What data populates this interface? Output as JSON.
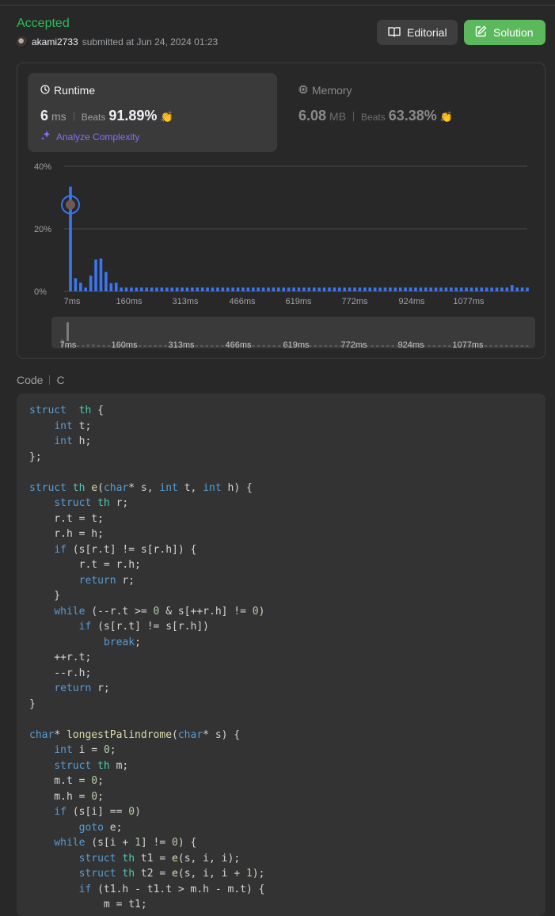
{
  "header": {
    "status": "Accepted",
    "username": "akami2733",
    "submitted_text": "submitted at Jun 24, 2024 01:23",
    "editorial_label": "Editorial",
    "solution_label": "Solution"
  },
  "runtime": {
    "title": "Runtime",
    "value": "6",
    "unit": "ms",
    "beats_label": "Beats",
    "beats_value": "91.89%",
    "analyze_label": "Analyze Complexity"
  },
  "memory": {
    "title": "Memory",
    "value": "6.08",
    "unit": "MB",
    "beats_label": "Beats",
    "beats_value": "63.38%"
  },
  "chart_data": {
    "type": "bar",
    "y_ticks": [
      "40%",
      "20%",
      "0%"
    ],
    "ylim": [
      0,
      40
    ],
    "x_tick_labels": [
      "7ms",
      "160ms",
      "313ms",
      "466ms",
      "619ms",
      "772ms",
      "924ms",
      "1077ms"
    ],
    "values": [
      33.5,
      4.2,
      2.8,
      1.2,
      5,
      10.2,
      10.5,
      6.2,
      2.6,
      2.8,
      1.2,
      1.2,
      1.2,
      1.2,
      1.2,
      1.2,
      1.2,
      1.2,
      1.2,
      1.2,
      1.2,
      1.2,
      1.2,
      1.2,
      1.2,
      1.2,
      1.2,
      1.2,
      1.2,
      1.2,
      1.2,
      1.2,
      1.2,
      1.2,
      1.2,
      1.2,
      1.2,
      1.2,
      1.2,
      1.2,
      1.2,
      1.2,
      1.2,
      1.2,
      1.2,
      1.2,
      1.2,
      1.2,
      1.2,
      1.2,
      1.2,
      1.2,
      1.2,
      1.2,
      1.2,
      1.2,
      1.2,
      1.2,
      1.2,
      1.2,
      1.2,
      1.2,
      1.2,
      1.2,
      1.2,
      1.2,
      1.2,
      1.2,
      1.2,
      1.2,
      1.2,
      1.2,
      1.2,
      1.2,
      1.2,
      1.2,
      1.2,
      1.2,
      1.2,
      1.2,
      1.2,
      1.2,
      1.2,
      1.2,
      1.2,
      1.2,
      1.2,
      2,
      1.2,
      1.2,
      1.2
    ],
    "highlight_index": 0,
    "bar_color": "#3a76f0",
    "grid": true
  },
  "code": {
    "label": "Code",
    "language": "C",
    "lines": [
      [
        [
          "kw",
          "struct"
        ],
        [
          "",
          "  "
        ],
        [
          "ty",
          "th"
        ],
        [
          "",
          " {"
        ]
      ],
      [
        [
          "",
          "    "
        ],
        [
          "kw",
          "int"
        ],
        [
          "",
          " t;"
        ]
      ],
      [
        [
          "",
          "    "
        ],
        [
          "kw",
          "int"
        ],
        [
          "",
          " h;"
        ]
      ],
      [
        [
          "",
          "};"
        ]
      ],
      [
        [
          "",
          ""
        ]
      ],
      [
        [
          "kw",
          "struct"
        ],
        [
          "",
          " "
        ],
        [
          "ty",
          "th"
        ],
        [
          "",
          " "
        ],
        [
          "fn",
          "e"
        ],
        [
          "",
          "("
        ],
        [
          "kw",
          "char"
        ],
        [
          "",
          "* s, "
        ],
        [
          "kw",
          "int"
        ],
        [
          "",
          " t, "
        ],
        [
          "kw",
          "int"
        ],
        [
          "",
          " h) {"
        ]
      ],
      [
        [
          "",
          "    "
        ],
        [
          "kw",
          "struct"
        ],
        [
          "",
          " "
        ],
        [
          "ty",
          "th"
        ],
        [
          "",
          " r;"
        ]
      ],
      [
        [
          "",
          "    r.t = t;"
        ]
      ],
      [
        [
          "",
          "    r.h = h;"
        ]
      ],
      [
        [
          "",
          "    "
        ],
        [
          "kw",
          "if"
        ],
        [
          "",
          " (s[r.t] != s[r.h]) {"
        ]
      ],
      [
        [
          "",
          "        r.t = r.h;"
        ]
      ],
      [
        [
          "",
          "        "
        ],
        [
          "kw",
          "return"
        ],
        [
          "",
          " r;"
        ]
      ],
      [
        [
          "",
          "    }"
        ]
      ],
      [
        [
          "",
          "    "
        ],
        [
          "kw",
          "while"
        ],
        [
          "",
          " (--r.t >= "
        ],
        [
          "num",
          "0"
        ],
        [
          "",
          " & s[++r.h] != "
        ],
        [
          "num",
          "0"
        ],
        [
          "",
          ")"
        ]
      ],
      [
        [
          "",
          "        "
        ],
        [
          "kw",
          "if"
        ],
        [
          "",
          " (s[r.t] != s[r.h])"
        ]
      ],
      [
        [
          "",
          "            "
        ],
        [
          "kw",
          "break"
        ],
        [
          "",
          ";"
        ]
      ],
      [
        [
          "",
          "    ++r.t;"
        ]
      ],
      [
        [
          "",
          "    --r.h;"
        ]
      ],
      [
        [
          "",
          "    "
        ],
        [
          "kw",
          "return"
        ],
        [
          "",
          " r;"
        ]
      ],
      [
        [
          "",
          "}"
        ]
      ],
      [
        [
          "",
          ""
        ]
      ],
      [
        [
          "kw",
          "char"
        ],
        [
          "",
          "* "
        ],
        [
          "fn",
          "longestPalindrome"
        ],
        [
          "",
          "("
        ],
        [
          "kw",
          "char"
        ],
        [
          "",
          "* s) {"
        ]
      ],
      [
        [
          "",
          "    "
        ],
        [
          "kw",
          "int"
        ],
        [
          "",
          " i = "
        ],
        [
          "num",
          "0"
        ],
        [
          "",
          ";"
        ]
      ],
      [
        [
          "",
          "    "
        ],
        [
          "kw",
          "struct"
        ],
        [
          "",
          " "
        ],
        [
          "ty",
          "th"
        ],
        [
          "",
          " m;"
        ]
      ],
      [
        [
          "",
          "    m.t = "
        ],
        [
          "num",
          "0"
        ],
        [
          "",
          ";"
        ]
      ],
      [
        [
          "",
          "    m.h = "
        ],
        [
          "num",
          "0"
        ],
        [
          "",
          ";"
        ]
      ],
      [
        [
          "",
          "    "
        ],
        [
          "kw",
          "if"
        ],
        [
          "",
          " (s[i] == "
        ],
        [
          "num",
          "0"
        ],
        [
          "",
          ")"
        ]
      ],
      [
        [
          "",
          "        "
        ],
        [
          "kw",
          "goto"
        ],
        [
          "",
          " e;"
        ]
      ],
      [
        [
          "",
          "    "
        ],
        [
          "kw",
          "while"
        ],
        [
          "",
          " (s[i + "
        ],
        [
          "num",
          "1"
        ],
        [
          "",
          "] != "
        ],
        [
          "num",
          "0"
        ],
        [
          "",
          ") {"
        ]
      ],
      [
        [
          "",
          "        "
        ],
        [
          "kw",
          "struct"
        ],
        [
          "",
          " "
        ],
        [
          "ty",
          "th"
        ],
        [
          "",
          " t1 = "
        ],
        [
          "fn",
          "e"
        ],
        [
          "",
          "(s, i, i);"
        ]
      ],
      [
        [
          "",
          "        "
        ],
        [
          "kw",
          "struct"
        ],
        [
          "",
          " "
        ],
        [
          "ty",
          "th"
        ],
        [
          "",
          " t2 = "
        ],
        [
          "fn",
          "e"
        ],
        [
          "",
          "(s, i, i + "
        ],
        [
          "num",
          "1"
        ],
        [
          "",
          ");"
        ]
      ],
      [
        [
          "",
          "        "
        ],
        [
          "kw",
          "if"
        ],
        [
          "",
          " (t1.h - t1.t > m.h - m.t) {"
        ]
      ],
      [
        [
          "",
          "            m = t1;"
        ]
      ]
    ]
  }
}
